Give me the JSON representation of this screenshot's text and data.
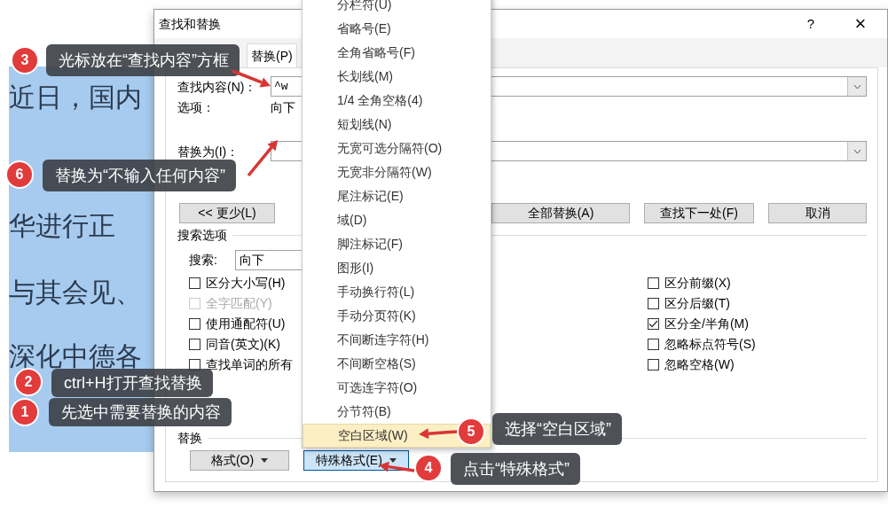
{
  "document": {
    "lines": [
      "近日，国内",
      "华进行正",
      "与其会见、",
      "深化中德各"
    ],
    "selected": true
  },
  "dialog": {
    "title": "查找和替换",
    "help": "?",
    "close": "×",
    "tabs": [
      {
        "label": "替换(P)",
        "selected": true
      }
    ],
    "find": {
      "label": "查找内容(N)：",
      "value": "^w"
    },
    "options": {
      "label": "选项：",
      "value": "向下"
    },
    "replace": {
      "label": "替换为(I)："
    },
    "less_button": "<< 更少(L)",
    "action_buttons": [
      "全部替换(A)",
      "查找下一处(F)",
      "取消"
    ],
    "search_options_title": "搜索选项",
    "search": {
      "label": "搜索:",
      "value": "向下"
    },
    "left_checks": [
      {
        "label": "区分大小写(H)",
        "checked": false,
        "disabled": false
      },
      {
        "label": "全字匹配(Y)",
        "checked": false,
        "disabled": true
      },
      {
        "label": "使用通配符(U)",
        "checked": false,
        "disabled": false
      },
      {
        "label": "同音(英文)(K)",
        "checked": false,
        "disabled": false
      },
      {
        "label": "查找单词的所有",
        "checked": false,
        "disabled": false
      }
    ],
    "right_checks": [
      {
        "label": "区分前缀(X)",
        "checked": false,
        "disabled": false
      },
      {
        "label": "区分后缀(T)",
        "checked": false,
        "disabled": false
      },
      {
        "label": "区分全/半角(M)",
        "checked": true,
        "disabled": false
      },
      {
        "label": "忽略标点符号(S)",
        "checked": false,
        "disabled": false
      },
      {
        "label": "忽略空格(W)",
        "checked": false,
        "disabled": false
      }
    ],
    "replace_title": "替换",
    "bottom_buttons": [
      {
        "label": "格式(O)",
        "pressed": false
      },
      {
        "label": "特殊格式(E)",
        "pressed": true
      }
    ]
  },
  "menu": {
    "items": [
      {
        "label": "分栏符(U)",
        "selected": false
      },
      {
        "label": "省略号(E)",
        "selected": false
      },
      {
        "label": "全角省略号(F)",
        "selected": false
      },
      {
        "label": "长划线(M)",
        "selected": false
      },
      {
        "label": "1/4 全角空格(4)",
        "selected": false
      },
      {
        "label": "短划线(N)",
        "selected": false
      },
      {
        "label": "无宽可选分隔符(O)",
        "selected": false
      },
      {
        "label": "无宽非分隔符(W)",
        "selected": false
      },
      {
        "label": "尾注标记(E)",
        "selected": false
      },
      {
        "label": "域(D)",
        "selected": false
      },
      {
        "label": "脚注标记(F)",
        "selected": false
      },
      {
        "label": "图形(I)",
        "selected": false
      },
      {
        "label": "手动换行符(L)",
        "selected": false
      },
      {
        "label": "手动分页符(K)",
        "selected": false
      },
      {
        "label": "不间断连字符(H)",
        "selected": false
      },
      {
        "label": "不间断空格(S)",
        "selected": false
      },
      {
        "label": "可选连字符(O)",
        "selected": false
      },
      {
        "label": "分节符(B)",
        "selected": false
      },
      {
        "label": "空白区域(W)",
        "selected": true
      }
    ]
  },
  "callouts": [
    {
      "number": "3",
      "text": "光标放在“查找内容”方框"
    },
    {
      "number": "6",
      "text": "替换为“不输入任何内容”"
    },
    {
      "number": "2",
      "text": "ctrl+H打开查找替换"
    },
    {
      "number": "1",
      "text": "先选中需要替换的内容"
    },
    {
      "number": "5",
      "text": "选择“空白区域”"
    },
    {
      "number": "4",
      "text": "点击“特殊格式”"
    }
  ]
}
